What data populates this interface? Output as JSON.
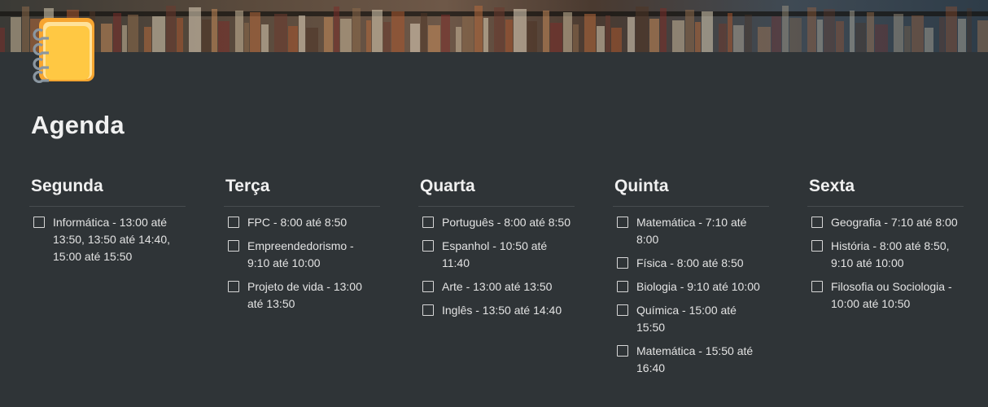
{
  "page": {
    "title": "Agenda",
    "icon": "notebook-icon"
  },
  "colors": {
    "background": "#2f3437",
    "text": "#e8e8e8",
    "divider": "#474c50",
    "icon_orange": "#f7a530",
    "icon_yellow": "#ffc843",
    "icon_ring": "#8a96a0"
  },
  "columns": [
    {
      "day": "Segunda",
      "items": [
        "Informática - 13:00 até 13:50, 13:50 até 14:40, 15:00 até 15:50"
      ]
    },
    {
      "day": "Terça",
      "items": [
        "FPC - 8:00 até 8:50",
        "Empreendedorismo - 9:10 até 10:00",
        "Projeto de vida - 13:00 até 13:50"
      ]
    },
    {
      "day": "Quarta",
      "items": [
        "Português - 8:00 até 8:50",
        "Espanhol - 10:50 até 11:40",
        "Arte - 13:00 até 13:50",
        "Inglês - 13:50 até 14:40"
      ]
    },
    {
      "day": "Quinta",
      "items": [
        "Matemática - 7:10 até 8:00",
        "Física - 8:00 até 8:50",
        "Biologia - 9:10 até 10:00",
        "Química - 15:00 até 15:50",
        "Matemática - 15:50 até 16:40"
      ]
    },
    {
      "day": "Sexta",
      "items": [
        "Geografia - 7:10 até 8:00",
        "História - 8:00 até 8:50, 9:10 até 10:00",
        "Filosofia ou Sociologia - 10:00 até 10:50"
      ]
    }
  ]
}
